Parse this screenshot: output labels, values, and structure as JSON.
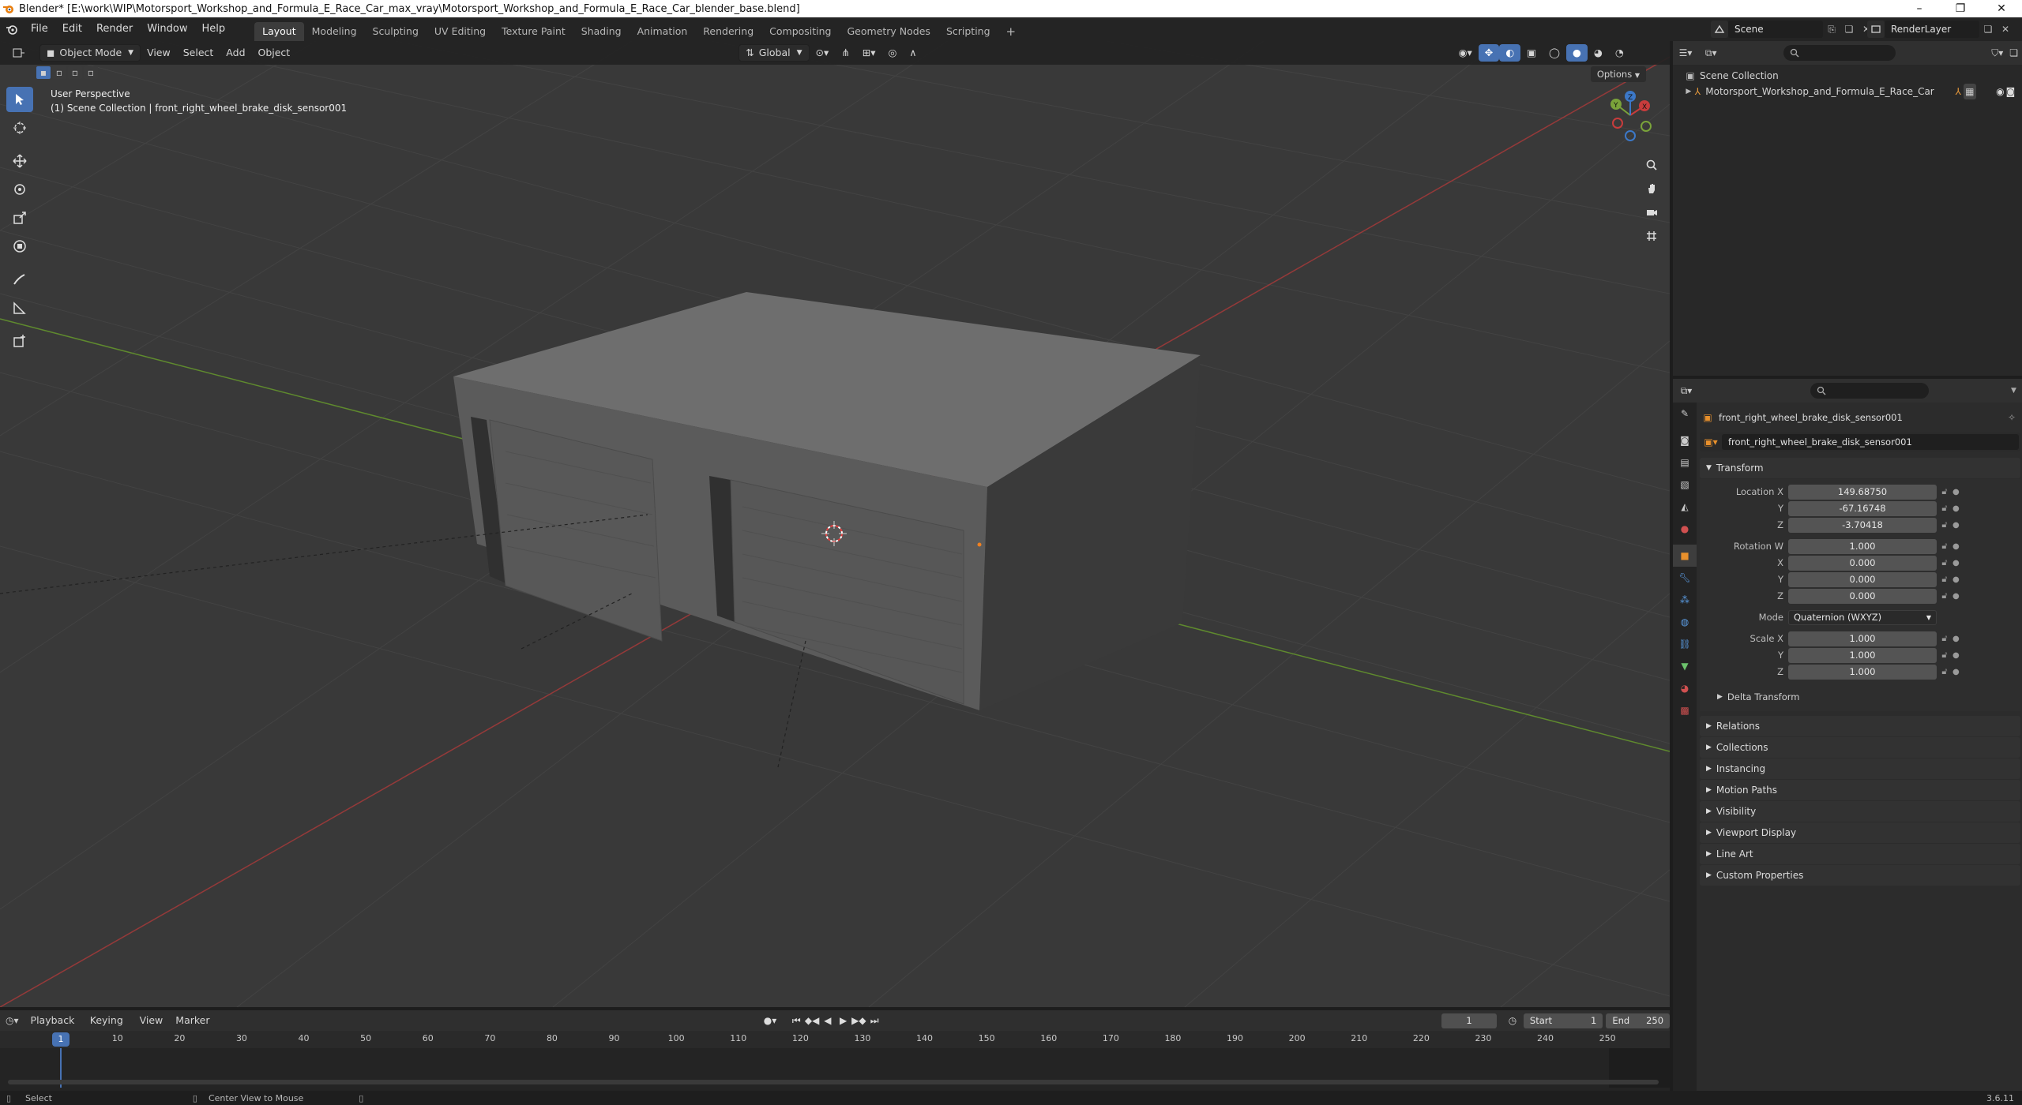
{
  "window": {
    "title": "Blender* [E:\\work\\WIP\\Motorsport_Workshop_and_Formula_E_Race_Car_max_vray\\Motorsport_Workshop_and_Formula_E_Race_Car_blender_base.blend]",
    "minimize": "–",
    "maximize": "❐",
    "close": "✕"
  },
  "menus": [
    "File",
    "Edit",
    "Render",
    "Window",
    "Help"
  ],
  "workspaces": [
    "Layout",
    "Modeling",
    "Sculpting",
    "UV Editing",
    "Texture Paint",
    "Shading",
    "Animation",
    "Rendering",
    "Compositing",
    "Geometry Nodes",
    "Scripting"
  ],
  "workspace_add": "+",
  "scene": {
    "name": "Scene",
    "render_layer": "RenderLayer"
  },
  "viewport": {
    "mode": "Object Mode",
    "menus": [
      "View",
      "Select",
      "Add",
      "Object"
    ],
    "orientation": "Global",
    "options": "Options",
    "perspective": "User Perspective",
    "collection_path": "(1) Scene Collection | front_right_wheel_brake_disk_sensor001",
    "gizmo": {
      "x": "X",
      "y": "Y",
      "z": "Z"
    }
  },
  "outliner": {
    "root": "Scene Collection",
    "items": [
      "Motorsport_Workshop_and_Formula_E_Race_Car"
    ]
  },
  "properties": {
    "object_name": "front_right_wheel_brake_disk_sensor001",
    "data_name": "front_right_wheel_brake_disk_sensor001",
    "transform_label": "Transform",
    "location": {
      "label": "Location X",
      "x": "149.68750",
      "y": "-67.16748",
      "z": "-3.70418"
    },
    "rotation": {
      "label": "Rotation W",
      "w": "1.000",
      "x": "0.000",
      "y": "0.000",
      "z": "0.000"
    },
    "mode": {
      "label": "Mode",
      "value": "Quaternion (WXYZ)"
    },
    "scale": {
      "label": "Scale X",
      "x": "1.000",
      "y": "1.000",
      "z": "1.000"
    },
    "axis_labels": {
      "y": "Y",
      "z": "Z",
      "x": "X"
    },
    "delta_transform": "Delta Transform",
    "sections": [
      "Relations",
      "Collections",
      "Instancing",
      "Motion Paths",
      "Visibility",
      "Viewport Display",
      "Line Art",
      "Custom Properties"
    ]
  },
  "timeline": {
    "menus": [
      "Playback",
      "Keying",
      "View",
      "Marker"
    ],
    "current_frame": "1",
    "start_label": "Start",
    "start": "1",
    "end_label": "End",
    "end": "250",
    "ticks": [
      "10",
      "20",
      "30",
      "40",
      "50",
      "60",
      "70",
      "80",
      "90",
      "100",
      "110",
      "120",
      "130",
      "140",
      "150",
      "160",
      "170",
      "180",
      "190",
      "200",
      "210",
      "220",
      "230",
      "240",
      "250"
    ]
  },
  "status": {
    "select": "Select",
    "center_view": "Center View to Mouse",
    "version": "3.6.11"
  },
  "colors": {
    "accent": "#4772b3",
    "x_axis": "#c83c3c",
    "y_axis": "#7aa33a",
    "z_axis": "#3c78c8"
  }
}
